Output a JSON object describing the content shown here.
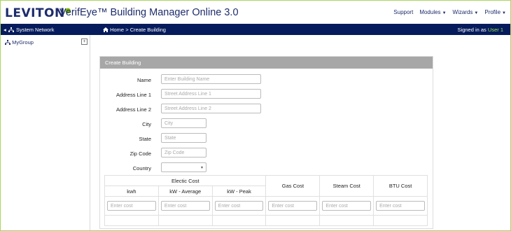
{
  "header": {
    "brand": "LEVITON",
    "brand_mark": "●",
    "app_title": "VerifEye™ Building Manager Online 3.0",
    "nav": {
      "support": "Support",
      "modules": "Modules",
      "wizards": "Wizards",
      "profile": "Profile"
    }
  },
  "bluebar": {
    "system_network": "System Network",
    "breadcrumb_home": "Home",
    "breadcrumb_sep": ">",
    "breadcrumb_page": "Create Building",
    "signed_in_prefix": "Signed in as",
    "signed_in_user": "User 1"
  },
  "sidebar": {
    "group_label": "MyGroup",
    "expander": "⊞"
  },
  "form": {
    "title": "Create Building",
    "fields": {
      "name": {
        "label": "Name",
        "placeholder": "Enter Building Name"
      },
      "address1": {
        "label": "Address Line 1",
        "placeholder": "Street Address Line 1"
      },
      "address2": {
        "label": "Address Line 2",
        "placeholder": "Street Address Line 2"
      },
      "city": {
        "label": "City",
        "placeholder": "City"
      },
      "state": {
        "label": "State",
        "placeholder": "State"
      },
      "zip": {
        "label": "Zip Code",
        "placeholder": "Zip Code"
      },
      "country": {
        "label": "Country",
        "value": ""
      }
    },
    "costs": {
      "electric_header": "Electic Cost",
      "gas_header": "Gas Cost",
      "steam_header": "Steam Cost",
      "btu_header": "BTU Cost",
      "kwh": "kwh",
      "kw_avg": "kW - Average",
      "kw_peak": "kW - Peak",
      "placeholder": "Enter cost"
    }
  },
  "colors": {
    "navy": "#061b5c",
    "brand_blue": "#1d2c6b",
    "accent_green": "#7ab800",
    "panel_header": "#a7a7a7"
  }
}
